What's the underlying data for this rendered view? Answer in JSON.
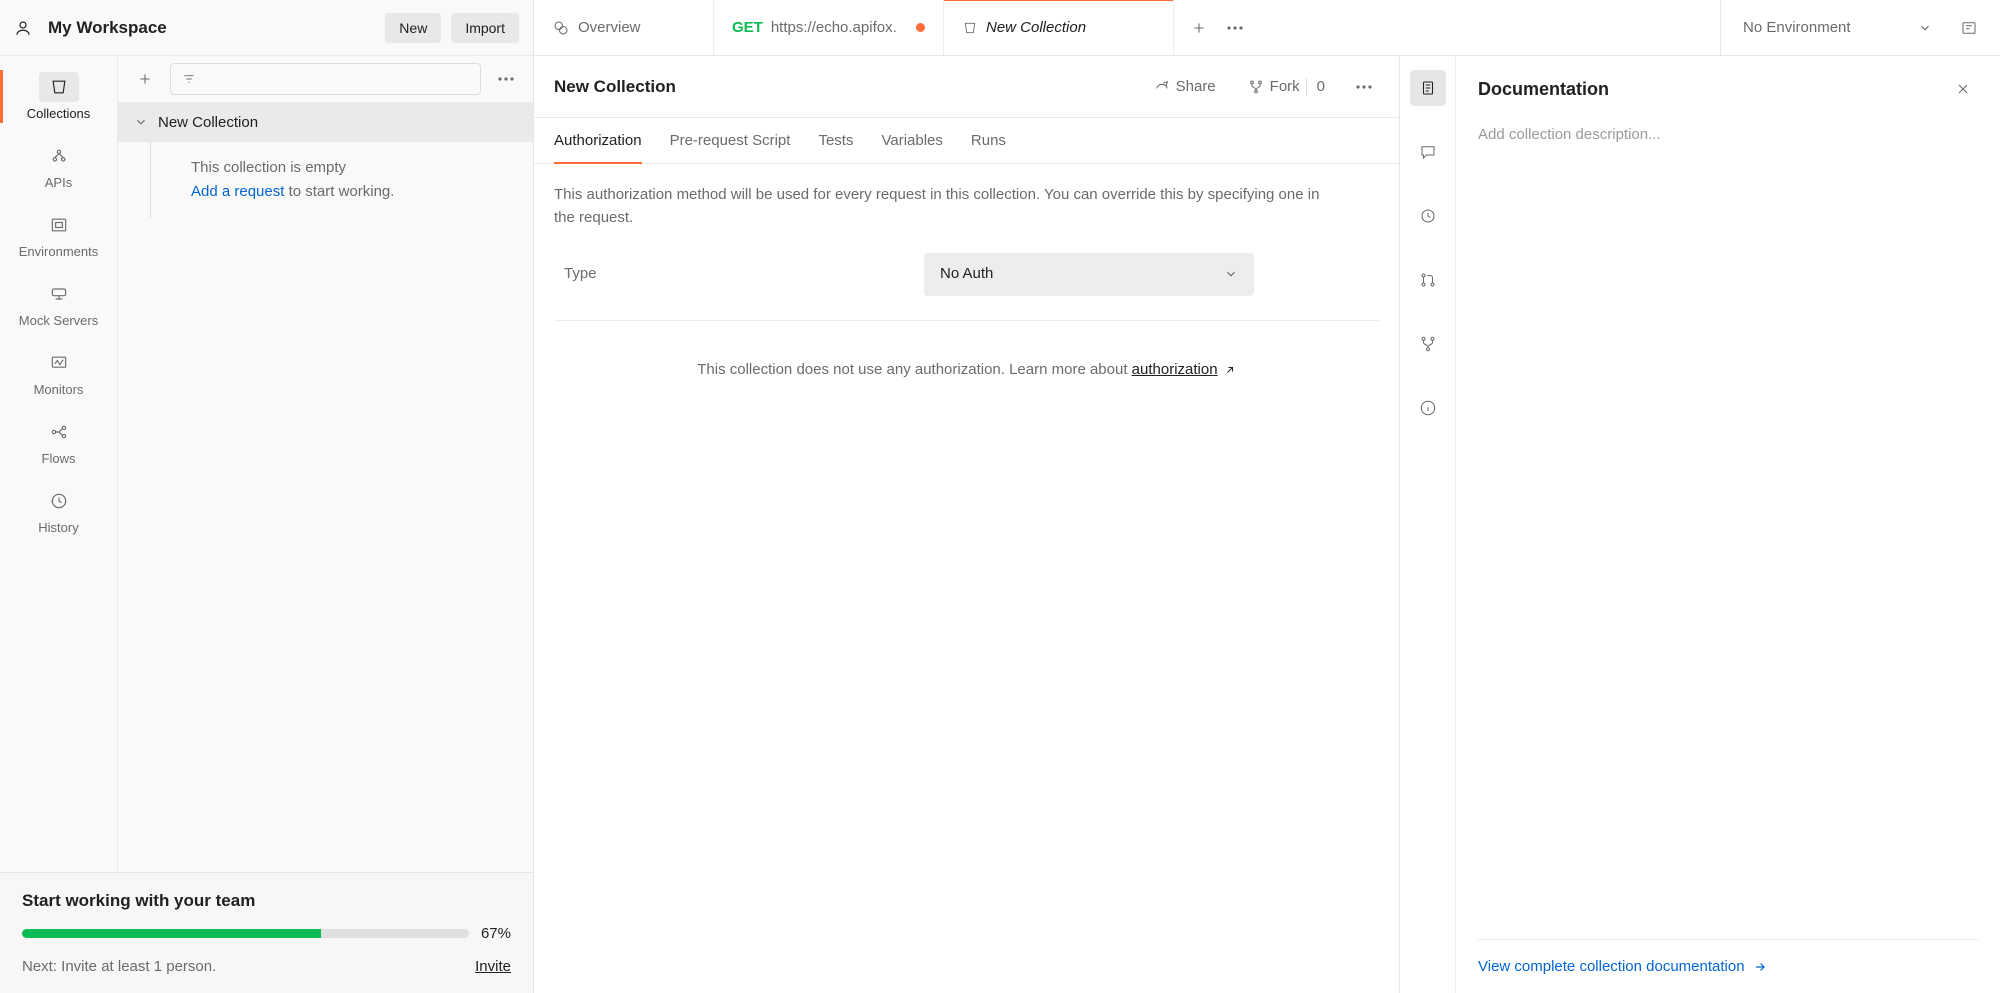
{
  "workspace": {
    "title": "My Workspace",
    "new_btn": "New",
    "import_btn": "Import"
  },
  "nav": {
    "collections": "Collections",
    "apis": "APIs",
    "envs": "Environments",
    "mock": "Mock Servers",
    "monitors": "Monitors",
    "flows": "Flows",
    "history": "History"
  },
  "coll_tree": {
    "item1": "New Collection",
    "empty_msg": "This collection is empty",
    "add_req": "Add a request",
    "empty_tail": " to start working."
  },
  "team": {
    "title": "Start working with your team",
    "pct_label": "67%",
    "pct": 67,
    "next": "Next: Invite at least 1 person.",
    "invite": "Invite"
  },
  "tabs": {
    "overview": "Overview",
    "get": "GET",
    "url": "https://echo.apifox.",
    "active": "New Collection"
  },
  "env": {
    "label": "No Environment"
  },
  "collection": {
    "title": "New Collection",
    "share": "Share",
    "fork": "Fork",
    "fork_count": "0",
    "tabs": {
      "auth": "Authorization",
      "pre": "Pre-request Script",
      "tests": "Tests",
      "vars": "Variables",
      "runs": "Runs"
    },
    "auth_desc": "This authorization method will be used for every request in this collection. You can override this by specifying one in the request.",
    "type_label": "Type",
    "type_value": "No Auth",
    "no_auth_note_a": "This collection does not use any authorization. Learn more about ",
    "no_auth_link": "authorization"
  },
  "doc": {
    "title": "Documentation",
    "placeholder": "Add collection description...",
    "view_link": "View complete collection documentation"
  }
}
